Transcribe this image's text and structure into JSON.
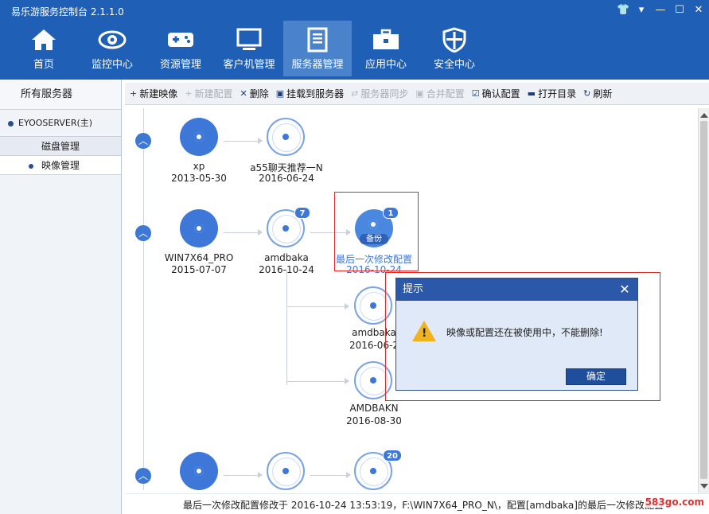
{
  "app": {
    "title": "易乐游服务控制台 2.1.1.0"
  },
  "nav": {
    "items": [
      {
        "label": "首页",
        "icon": "home-icon"
      },
      {
        "label": "监控中心",
        "icon": "eye-icon"
      },
      {
        "label": "资源管理",
        "icon": "gamepad-icon"
      },
      {
        "label": "客户机管理",
        "icon": "monitor-icon"
      },
      {
        "label": "服务器管理",
        "icon": "server-icon",
        "active": true
      },
      {
        "label": "应用中心",
        "icon": "toolbox-icon"
      },
      {
        "label": "安全中心",
        "icon": "shield-icon"
      }
    ]
  },
  "sidebar": {
    "header": "所有服务器",
    "server": "EYOOSERVER(主)",
    "items": [
      {
        "label": "磁盘管理"
      },
      {
        "label": "映像管理",
        "selected": true
      }
    ]
  },
  "toolbar": {
    "items": [
      {
        "label": "新建映像",
        "icon": "+",
        "enabled": true
      },
      {
        "label": "新建配置",
        "icon": "+",
        "enabled": false
      },
      {
        "label": "删除",
        "icon": "✕",
        "enabled": true
      },
      {
        "label": "挂载到服务器",
        "icon": "▣",
        "enabled": true
      },
      {
        "label": "服务器同步",
        "icon": "⇄",
        "enabled": false
      },
      {
        "label": "合并配置",
        "icon": "▣",
        "enabled": false
      },
      {
        "label": "确认配置",
        "icon": "☑",
        "enabled": true
      },
      {
        "label": "打开目录",
        "icon": "▬",
        "enabled": true
      },
      {
        "label": "刷新",
        "icon": "↻",
        "enabled": true
      }
    ]
  },
  "images": {
    "row1": {
      "base": {
        "name": "xp",
        "date": "2013-05-30"
      },
      "child": {
        "name": "a55聊天推荐一N",
        "date": "2016-06-24"
      }
    },
    "row2": {
      "base": {
        "name": "WIN7X64_PRO",
        "date": "2015-07-07"
      },
      "child": {
        "name": "amdbaka",
        "date": "2016-10-24",
        "badge": "7"
      },
      "backup": {
        "name": "最后一次修改配置",
        "date": "2016-10-24",
        "badge": "1",
        "tag": "备份"
      },
      "branch1": {
        "name": "amdbaka",
        "date": "2016-06-2"
      },
      "branch2": {
        "name": "AMDBAKN",
        "date": "2016-08-30"
      }
    },
    "row3": {
      "badge": "20"
    }
  },
  "dialog": {
    "title": "提示",
    "message": "映像或配置还在被使用中，不能删除!",
    "ok_label": "确定"
  },
  "status": {
    "text": "最后一次修改配置修改于 2016-10-24 13:53:19，F:\\WIN7X64_PRO_N\\，配置[amdbaka]的最后一次修改配置",
    "watermark": "583go.com"
  },
  "colors": {
    "header": "#1f5fb5",
    "accent": "#3d77d8",
    "dialog_title": "#2b58a8",
    "highlight": "#e02a2a"
  }
}
